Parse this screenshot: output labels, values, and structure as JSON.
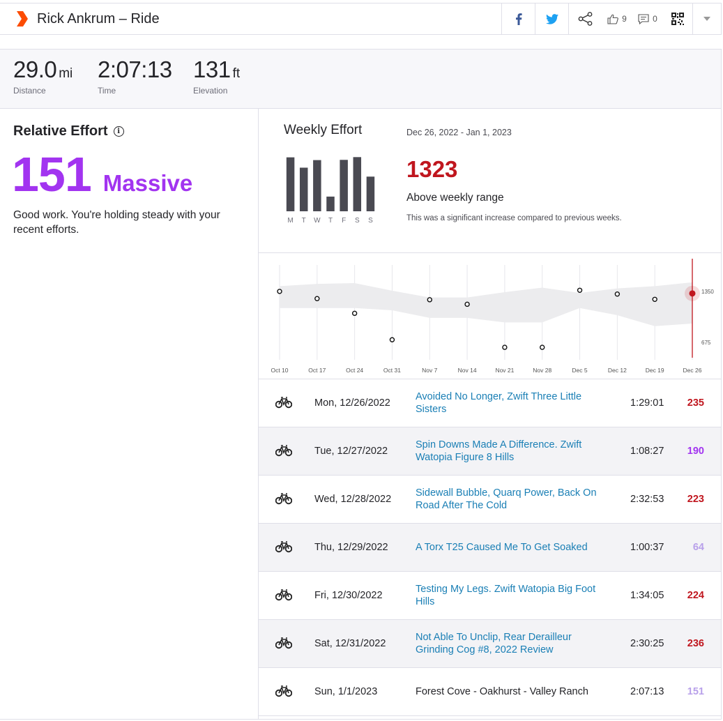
{
  "header": {
    "title": "Rick Ankrum – Ride",
    "kudos_count": "9",
    "comment_count": "0",
    "colors": {
      "brand": "#fc4c02",
      "facebook": "#3b5998",
      "twitter": "#1da1f2"
    },
    "icons": [
      "facebook-icon",
      "twitter-icon",
      "share-icon",
      "thumbs-up-icon",
      "comment-icon",
      "qr-code-icon",
      "chevron-down-icon"
    ]
  },
  "stats": [
    {
      "value": "29.0",
      "unit": "mi",
      "label": "Distance"
    },
    {
      "value": "2:07:13",
      "unit": "",
      "label": "Time"
    },
    {
      "value": "131",
      "unit": "ft",
      "label": "Elevation"
    }
  ],
  "relative_effort": {
    "title": "Relative Effort",
    "score": "151",
    "level": "Massive",
    "message": "Good work. You're holding steady with your recent efforts.",
    "color": "#a234f0"
  },
  "weekly_effort": {
    "title": "Weekly Effort",
    "date_range": "Dec 26, 2022 - Jan 1, 2023",
    "total": "1323",
    "status": "Above weekly range",
    "description": "This was a significant increase compared to previous weeks.",
    "days": [
      "M",
      "T",
      "W",
      "T",
      "F",
      "S",
      "S"
    ],
    "day_values": [
      235,
      190,
      223,
      64,
      224,
      236,
      151
    ],
    "total_color": "#c0161e"
  },
  "chart_data": {
    "type": "scatter",
    "x": [
      "Oct 10",
      "Oct 17",
      "Oct 24",
      "Oct 31",
      "Nov 7",
      "Nov 14",
      "Nov 21",
      "Nov 28",
      "Dec 5",
      "Dec 12",
      "Dec 19",
      "Dec 26"
    ],
    "values": [
      1350,
      1255,
      1060,
      710,
      1240,
      1180,
      610,
      610,
      1365,
      1315,
      1245,
      1323
    ],
    "range_upper": [
      1420,
      1450,
      1460,
      1360,
      1270,
      1270,
      1340,
      1400,
      1330,
      1390,
      1420,
      1470
    ],
    "range_lower": [
      1130,
      1130,
      1130,
      1100,
      1000,
      1000,
      940,
      940,
      1130,
      1035,
      890,
      925
    ],
    "y_ticks": [
      675,
      1350
    ],
    "ylim": [
      500,
      1700
    ],
    "highlight_index": 11,
    "highlight_color": "#c0161e"
  },
  "activities": [
    {
      "date": "Mon, 12/26/2022",
      "name": "Avoided No Longer, Zwift Three Little Sisters",
      "time": "1:29:01",
      "effort": "235",
      "effort_color": "#c0161e",
      "link": true
    },
    {
      "date": "Tue, 12/27/2022",
      "name": "Spin Downs Made A Difference. Zwift Watopia Figure 8 Hills",
      "time": "1:08:27",
      "effort": "190",
      "effort_color": "#a234f0",
      "link": true
    },
    {
      "date": "Wed, 12/28/2022",
      "name": "Sidewall Bubble, Quarq Power, Back On Road After The Cold",
      "time": "2:32:53",
      "effort": "223",
      "effort_color": "#c0161e",
      "link": true
    },
    {
      "date": "Thu, 12/29/2022",
      "name": "A Torx T25 Caused Me To Get Soaked",
      "time": "1:00:37",
      "effort": "64",
      "effort_color": "#b8a0ea",
      "link": true
    },
    {
      "date": "Fri, 12/30/2022",
      "name": "Testing My Legs. Zwift Watopia Big Foot Hills",
      "time": "1:34:05",
      "effort": "224",
      "effort_color": "#c0161e",
      "link": true
    },
    {
      "date": "Sat, 12/31/2022",
      "name": "Not Able To Unclip, Rear Derailleur Grinding Cog #8, 2022 Review",
      "time": "2:30:25",
      "effort": "236",
      "effort_color": "#c0161e",
      "link": true
    },
    {
      "date": "Sun, 1/1/2023",
      "name": "Forest Cove - Oakhurst - Valley Ranch",
      "time": "2:07:13",
      "effort": "151",
      "effort_color": "#b8a0ea",
      "link": false
    }
  ]
}
